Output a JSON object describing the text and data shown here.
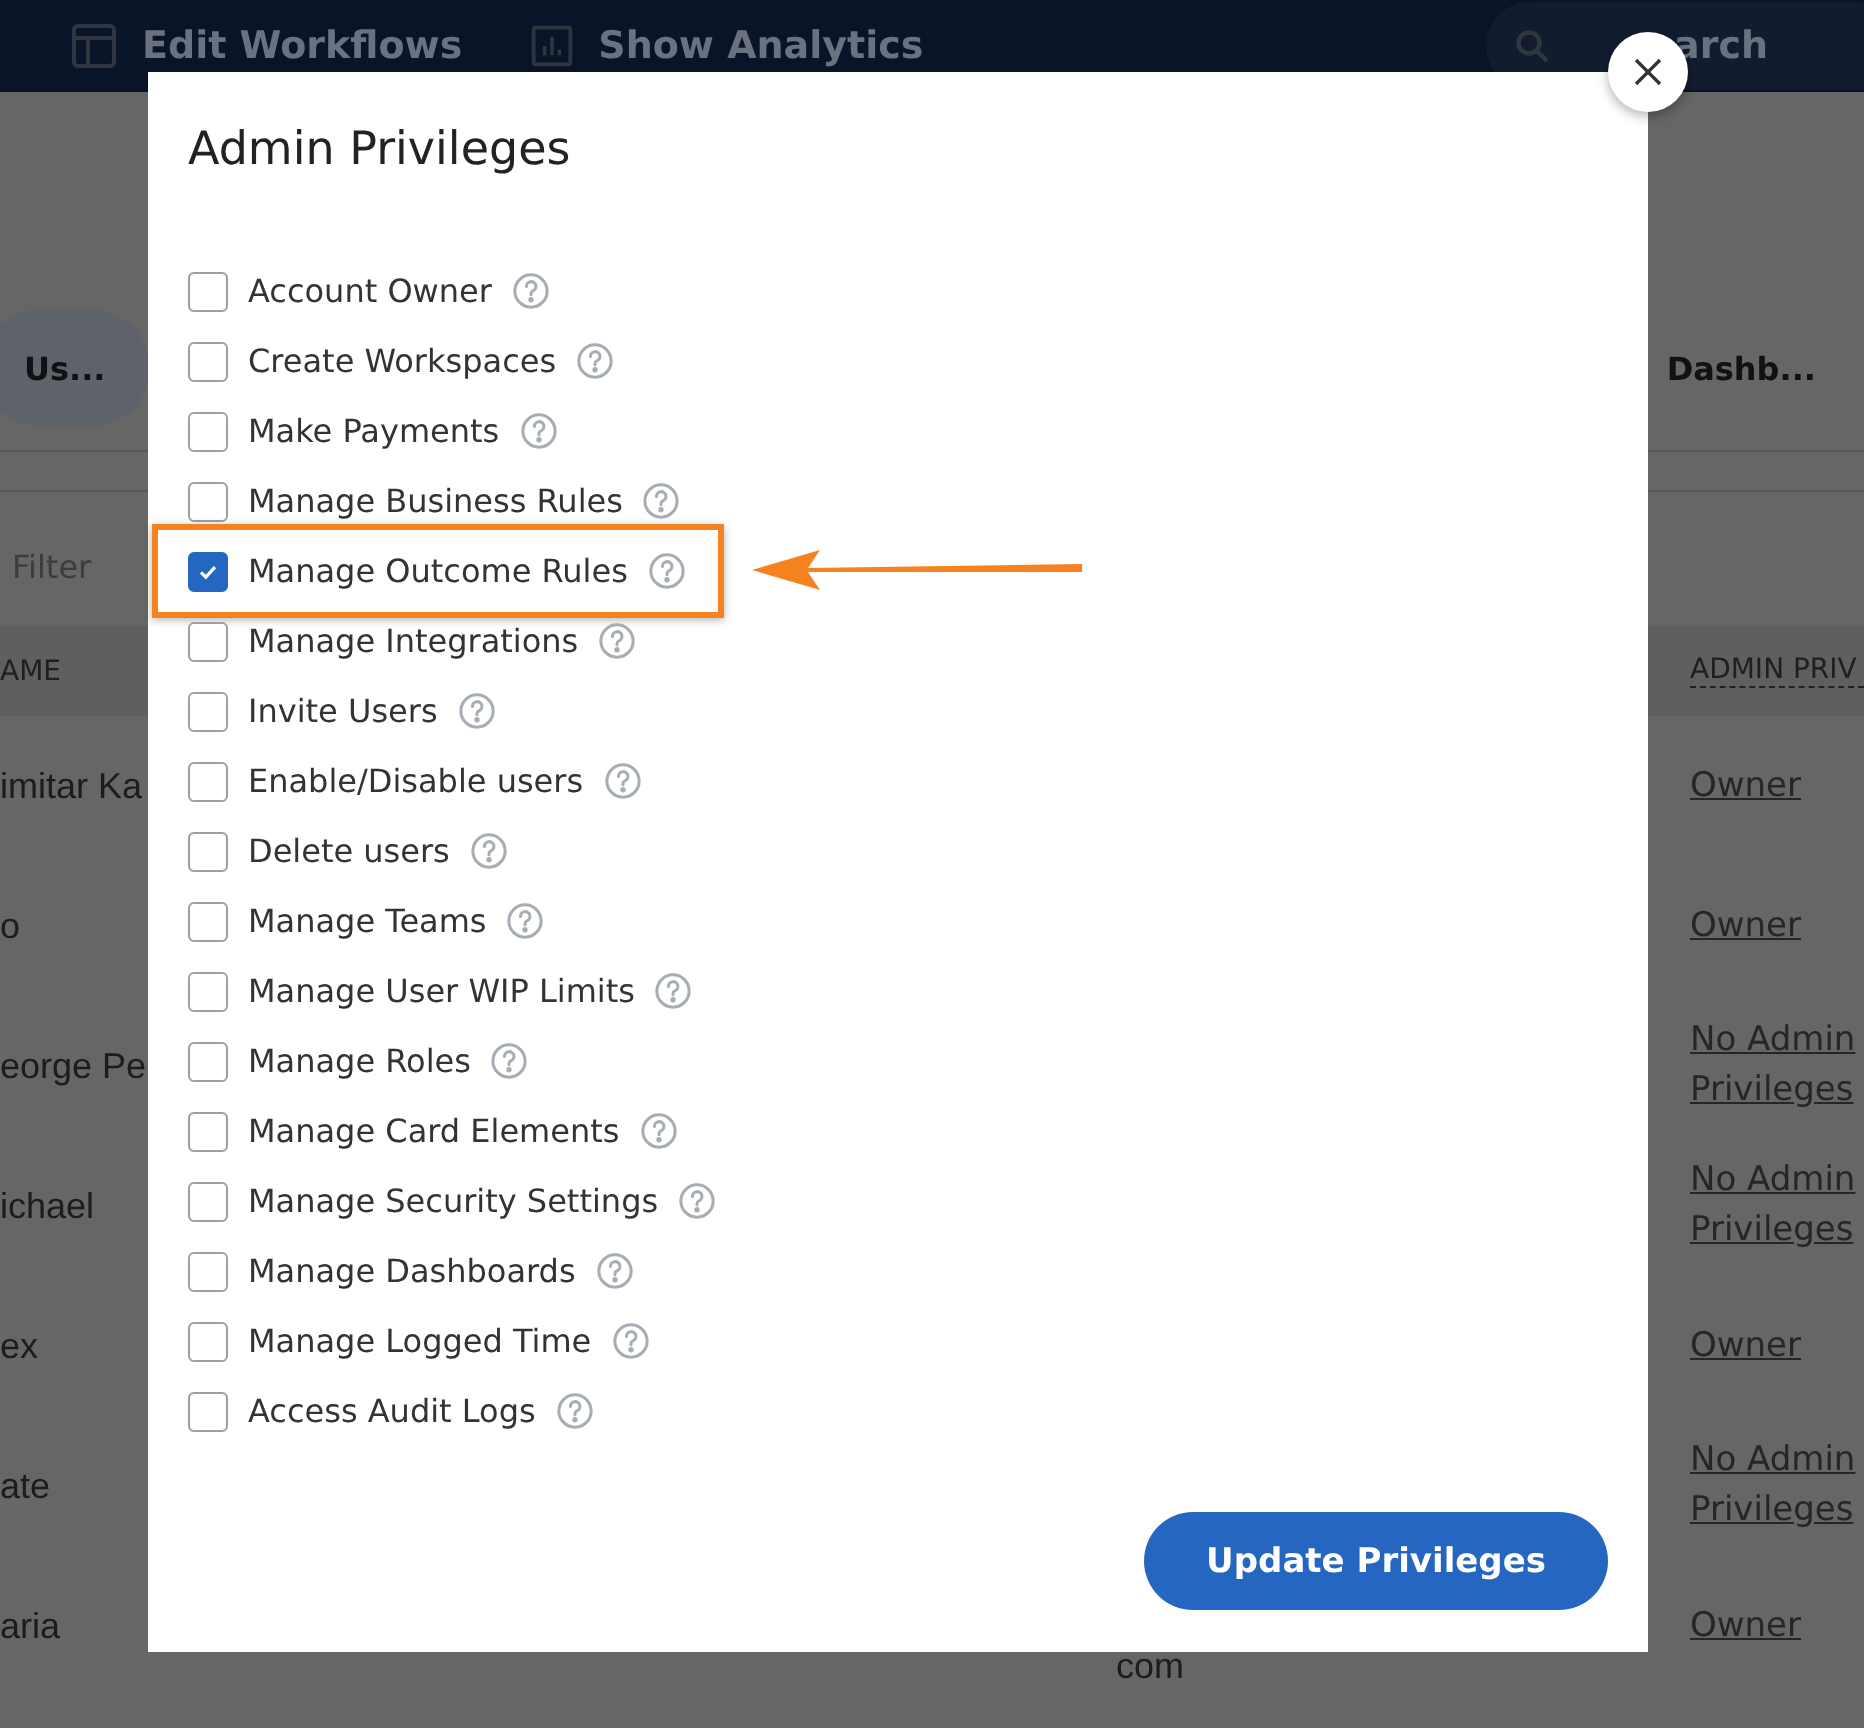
{
  "nav": {
    "items": [
      {
        "label": "Edit Workflows",
        "kind": "table"
      },
      {
        "label": "Show Analytics",
        "kind": "chart"
      }
    ],
    "search": {
      "placeholder": "arch"
    }
  },
  "tabs": [
    {
      "label": "Us...",
      "selected": true
    },
    {
      "label": "Dashb...",
      "selected": false
    }
  ],
  "filter": {
    "placeholder": "Filter"
  },
  "table": {
    "columns": [
      "AME",
      "ADMIN PRIV"
    ],
    "rows": [
      {
        "name": "imitar Ka",
        "admin": "Owner"
      },
      {
        "name": "o",
        "admin": "Owner"
      },
      {
        "name": "eorge Pe",
        "admin": "No Admin Privileges"
      },
      {
        "name": "ichael",
        "admin": "No Admin Privileges"
      },
      {
        "name": "ex",
        "admin": "Owner"
      },
      {
        "name": "ate",
        "admin": "No Admin Privileges"
      },
      {
        "name": "aria",
        "email": "com",
        "admin": "Owner"
      }
    ]
  },
  "dialog": {
    "title": "Admin Privileges",
    "privileges": [
      {
        "label": "Account Owner",
        "checked": false,
        "annotated": false
      },
      {
        "label": "Create Workspaces",
        "checked": false,
        "annotated": false
      },
      {
        "label": "Make Payments",
        "checked": false,
        "annotated": false
      },
      {
        "label": "Manage Business Rules",
        "checked": false,
        "annotated": false
      },
      {
        "label": "Manage Outcome Rules",
        "checked": true,
        "annotated": true
      },
      {
        "label": "Manage Integrations",
        "checked": false,
        "annotated": false
      },
      {
        "label": "Invite Users",
        "checked": false,
        "annotated": false
      },
      {
        "label": "Enable/Disable users",
        "checked": false,
        "annotated": false
      },
      {
        "label": "Delete users",
        "checked": false,
        "annotated": false
      },
      {
        "label": "Manage Teams",
        "checked": false,
        "annotated": false
      },
      {
        "label": "Manage User WIP Limits",
        "checked": false,
        "annotated": false
      },
      {
        "label": "Manage Roles",
        "checked": false,
        "annotated": false
      },
      {
        "label": "Manage Card Elements",
        "checked": false,
        "annotated": false
      },
      {
        "label": "Manage Security Settings",
        "checked": false,
        "annotated": false
      },
      {
        "label": "Manage Dashboards",
        "checked": false,
        "annotated": false
      },
      {
        "label": "Manage Logged Time",
        "checked": false,
        "annotated": false
      },
      {
        "label": "Access Audit Logs",
        "checked": false,
        "annotated": false
      }
    ],
    "button": "Update Privileges"
  }
}
